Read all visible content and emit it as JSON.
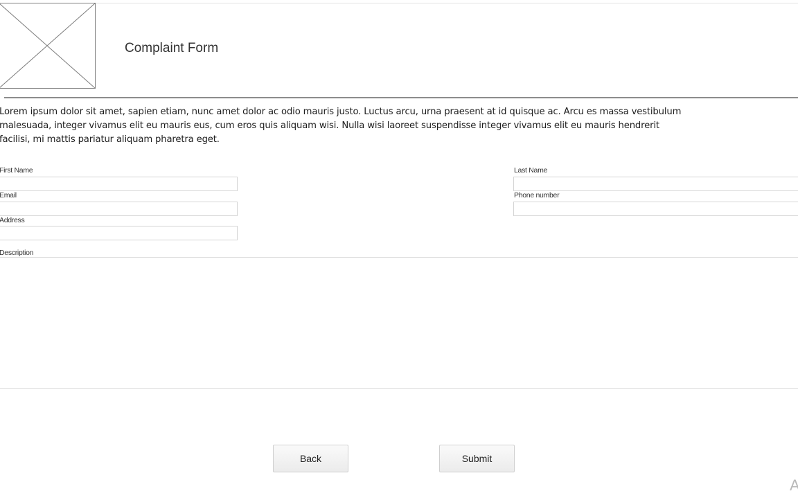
{
  "header": {
    "logo_icon": "image-placeholder-icon",
    "title": "Complaint Form"
  },
  "intro": {
    "lines": [
      "Lorem ipsum dolor sit amet, sapien etiam, nunc amet dolor ac odio mauris justo. Luctus arcu, urna praesent at id quisque ac. Arcu es massa vestibulum",
      "malesuada, integer vivamus elit eu mauris eus, cum eros quis aliquam wisi. Nulla wisi laoreet suspendisse integer vivamus elit eu mauris hendrerit",
      "facilisi, mi mattis pariatur aliquam pharetra eget."
    ]
  },
  "form": {
    "first_name": {
      "label": "First Name",
      "value": ""
    },
    "last_name": {
      "label": "Last Name",
      "value": ""
    },
    "email": {
      "label": "Email",
      "value": ""
    },
    "phone": {
      "label": "Phone number",
      "value": ""
    },
    "address": {
      "label": "Address",
      "value": ""
    },
    "description": {
      "label": "Description",
      "value": ""
    }
  },
  "buttons": {
    "back": "Back",
    "submit": "Submit"
  },
  "corner_glyph": "A"
}
